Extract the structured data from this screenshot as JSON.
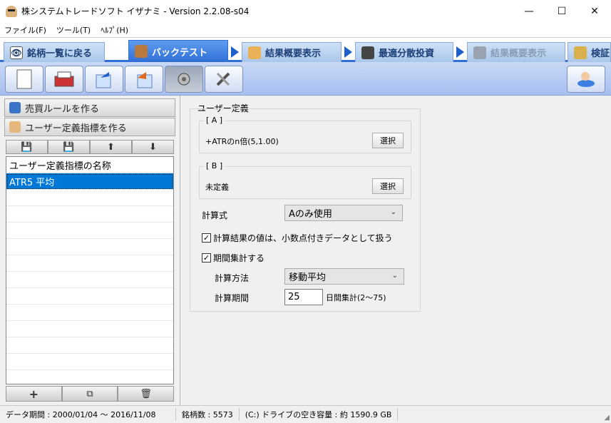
{
  "window": {
    "title": "株システムトレードソフト イザナミ - Version 2.2.08-s04",
    "minimize": "—",
    "maximize": "☐",
    "close": "✕"
  },
  "menu": [
    "ファイル(F)",
    "ツール(T)",
    "ﾍﾙﾌﾟ(H)"
  ],
  "tabs": [
    {
      "label": "銘柄一覧に戻る",
      "icon": "eye-icon",
      "state": "normal"
    },
    {
      "label": "バックテスト",
      "icon": "bag-icon",
      "state": "active"
    },
    {
      "label": "結果概要表示",
      "icon": "hand-icon",
      "state": "normal"
    },
    {
      "label": "最適分散投資",
      "icon": "grid-icon",
      "state": "normal"
    },
    {
      "label": "結果概要表示",
      "icon": "factory-icon",
      "state": "disabled"
    },
    {
      "label": "検証",
      "icon": "notebook-icon",
      "state": "normal"
    }
  ],
  "toolbar": {
    "buttons": [
      "new-document-icon",
      "open-folder-icon",
      "export-icon",
      "import-icon",
      "settings-gear-icon",
      "tools-icon"
    ],
    "right_button": "chat-hand-icon"
  },
  "left": {
    "rules_button": "売買ルールを作る",
    "indicator_button": "ユーザー定義指標を作る",
    "list_header": "ユーザー定義指標の名称",
    "items": [
      "ATR5 平均",
      "",
      "",
      "",
      "",
      "",
      "",
      "",
      "",
      "",
      "",
      "",
      ""
    ]
  },
  "right": {
    "group_title": "ユーザー定義",
    "a_title": "[ A ]",
    "a_value": "+ATRのn倍(5,1.00)",
    "a_select": "選択",
    "b_title": "[ B ]",
    "b_value": "未定義",
    "b_select": "選択",
    "formula_label": "計算式",
    "formula_value": "Aのみ使用",
    "decimal_check": "計算結果の値は、小数点付きデータとして扱う",
    "period_check": "期間集計する",
    "method_label": "計算方法",
    "method_value": "移動平均",
    "period_label": "計算期間",
    "period_value": "25",
    "period_hint": "日間集計(2〜75)"
  },
  "status": {
    "period": "データ期間 : 2000/01/04 〜 2016/11/08",
    "count": "銘柄数 : 5573",
    "disk": "(C:) ドライブの空き容量 : 約 1590.9 GB"
  },
  "colors": {
    "accent": "#2f6fd6",
    "selection": "#0078d7"
  }
}
